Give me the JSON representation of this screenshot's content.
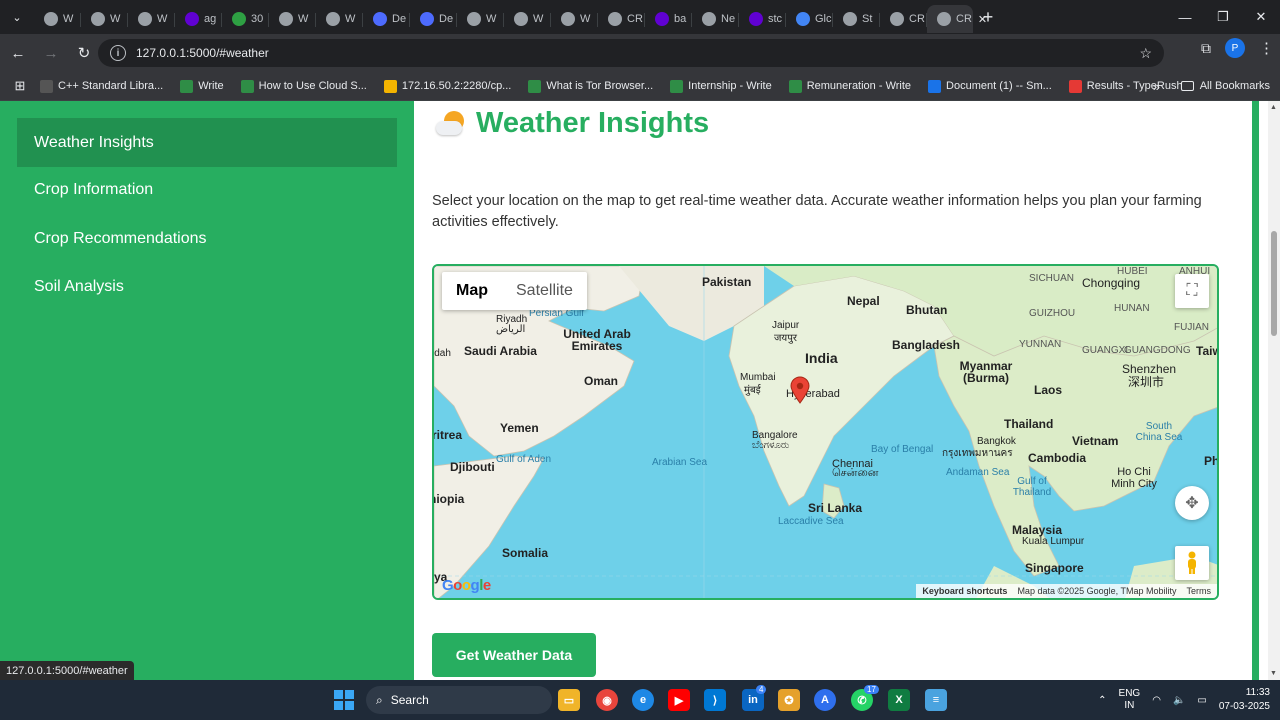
{
  "browser": {
    "tabs": [
      {
        "label": "W",
        "icon": "globe-icon",
        "color": "#9aa0a6"
      },
      {
        "label": "W",
        "icon": "globe-icon",
        "color": "#9aa0a6"
      },
      {
        "label": "W",
        "icon": "openai-icon",
        "color": "#9aa0a6"
      },
      {
        "label": "ag",
        "icon": "yahoo-icon",
        "color": "#6001d2"
      },
      {
        "label": "30",
        "icon": "px-icon",
        "color": "#2ea043"
      },
      {
        "label": "W",
        "icon": "globe-icon",
        "color": "#9aa0a6"
      },
      {
        "label": "W",
        "icon": "globe-icon",
        "color": "#9aa0a6"
      },
      {
        "label": "De",
        "icon": "deepseek-icon",
        "color": "#4d6bfe"
      },
      {
        "label": "De",
        "icon": "deepseek-icon",
        "color": "#4d6bfe"
      },
      {
        "label": "W",
        "icon": "globe-icon",
        "color": "#9aa0a6"
      },
      {
        "label": "W",
        "icon": "globe-icon",
        "color": "#9aa0a6"
      },
      {
        "label": "W",
        "icon": "globe-icon",
        "color": "#9aa0a6"
      },
      {
        "label": "CR",
        "icon": "globe-icon",
        "color": "#9aa0a6"
      },
      {
        "label": "ba",
        "icon": "yahoo-icon",
        "color": "#6001d2"
      },
      {
        "label": "Ne",
        "icon": "globe-icon",
        "color": "#9aa0a6"
      },
      {
        "label": "stc",
        "icon": "yahoo-icon",
        "color": "#6001d2"
      },
      {
        "label": "Glc",
        "icon": "spark-icon",
        "color": "#4285f4"
      },
      {
        "label": "St",
        "icon": "spark-icon",
        "color": "#9aa0a6"
      },
      {
        "label": "CR",
        "icon": "globe-icon",
        "color": "#9aa0a6"
      },
      {
        "label": "CR",
        "icon": "globe-icon",
        "color": "#9aa0a6"
      }
    ],
    "url": "127.0.0.1:5000/#weather",
    "profile_initial": "P",
    "bookmarks": [
      {
        "label": "C++ Standard Libra...",
        "icon": "cpp-icon",
        "color": "#555"
      },
      {
        "label": "Write",
        "icon": "gfg-icon",
        "color": "#2f8d46"
      },
      {
        "label": "How to Use Cloud S...",
        "icon": "gfg-icon",
        "color": "#2f8d46"
      },
      {
        "label": "172.16.50.2:2280/cp...",
        "icon": "gmail-icon",
        "color": "#f4b400"
      },
      {
        "label": "What is Tor Browser...",
        "icon": "gfg-icon",
        "color": "#2f8d46"
      },
      {
        "label": "Internship - Write",
        "icon": "gfg-icon",
        "color": "#2f8d46"
      },
      {
        "label": "Remuneration - Write",
        "icon": "gfg-icon",
        "color": "#2f8d46"
      },
      {
        "label": "Document (1) -- Sm...",
        "icon": "smallpdf-icon",
        "color": "#1a73e8"
      },
      {
        "label": "Results - TypeRush",
        "icon": "typerush-icon",
        "color": "#e53935"
      }
    ],
    "all_bookmarks": "All Bookmarks",
    "status_url": "127.0.0.1:5000/#weather"
  },
  "sidebar": {
    "items": [
      {
        "label": "Weather Insights",
        "active": true
      },
      {
        "label": "Crop Information",
        "active": false
      },
      {
        "label": "Crop Recommendations",
        "active": false
      },
      {
        "label": "Soil Analysis",
        "active": false
      }
    ]
  },
  "main": {
    "title": "Weather Insights",
    "intro": "Select your location on the map to get real-time weather data. Accurate weather information helps you plan your farming activities effectively.",
    "button": "Get Weather Data"
  },
  "map": {
    "type_buttons": [
      "Map",
      "Satellite"
    ],
    "selected_type": "Map",
    "labels": [
      {
        "text": "Pakistan",
        "kind": "big-lite"
      },
      {
        "text": "SICHUAN",
        "kind": "small"
      },
      {
        "text": "Chongqing",
        "kind": "label"
      },
      {
        "text": "HUBEI",
        "kind": "small"
      },
      {
        "text": "ANHUI",
        "kind": "small"
      },
      {
        "text": "Nepal",
        "kind": "label"
      },
      {
        "text": "Bhutan",
        "kind": "label"
      },
      {
        "text": "GUIZHOU",
        "kind": "small"
      },
      {
        "text": "HUNAN",
        "kind": "small"
      },
      {
        "text": "FUJIAN",
        "kind": "small"
      },
      {
        "text": "Persian Gulf",
        "kind": "sea"
      },
      {
        "text": "Riyadh",
        "kind": "label"
      },
      {
        "text": "الرياض",
        "kind": "label"
      },
      {
        "text": "United Arab Emirates",
        "kind": "label"
      },
      {
        "text": "Jaipur",
        "kind": "label"
      },
      {
        "text": "जयपुर",
        "kind": "label"
      },
      {
        "text": "Bangladesh",
        "kind": "label"
      },
      {
        "text": "YUNNAN",
        "kind": "small"
      },
      {
        "text": "GUANGXI",
        "kind": "small"
      },
      {
        "text": "GUANGDONG",
        "kind": "small"
      },
      {
        "text": "Taiw",
        "kind": "label"
      },
      {
        "text": "Saudi Arabia",
        "kind": "big-lite"
      },
      {
        "text": "India",
        "kind": "big"
      },
      {
        "text": "Myanmar (Burma)",
        "kind": "label"
      },
      {
        "text": "Shenzhen",
        "kind": "label"
      },
      {
        "text": "深圳市",
        "kind": "label"
      },
      {
        "text": "Oman",
        "kind": "label"
      },
      {
        "text": "Mumbai",
        "kind": "label"
      },
      {
        "text": "मुंबई",
        "kind": "label"
      },
      {
        "text": "Hyderabad",
        "kind": "label"
      },
      {
        "text": "Laos",
        "kind": "label"
      },
      {
        "text": "Yemen",
        "kind": "label"
      },
      {
        "text": "Thailand",
        "kind": "label"
      },
      {
        "text": "Vietnam",
        "kind": "label"
      },
      {
        "text": "South China Sea",
        "kind": "sea"
      },
      {
        "text": "Bangalore",
        "kind": "label"
      },
      {
        "text": "ಬೆಂಗಳೂರು",
        "kind": "label"
      },
      {
        "text": "Bay of Bengal",
        "kind": "sea"
      },
      {
        "text": "Bangkok",
        "kind": "label"
      },
      {
        "text": "กรุงเทพมหานคร",
        "kind": "label"
      },
      {
        "text": "Gulf of Aden",
        "kind": "sea"
      },
      {
        "text": "Arabian Sea",
        "kind": "sea"
      },
      {
        "text": "Chennai",
        "kind": "label"
      },
      {
        "text": "சென்னை",
        "kind": "label"
      },
      {
        "text": "Cambodia",
        "kind": "label"
      },
      {
        "text": "Djibouti",
        "kind": "label"
      },
      {
        "text": "Andaman Sea",
        "kind": "sea"
      },
      {
        "text": "Ho Chi Minh City",
        "kind": "label"
      },
      {
        "text": "Ph",
        "kind": "label"
      },
      {
        "text": "Gulf of Thailand",
        "kind": "sea"
      },
      {
        "text": "Sri Lanka",
        "kind": "label"
      },
      {
        "text": "Laccadive Sea",
        "kind": "sea"
      },
      {
        "text": "Malaysia",
        "kind": "label"
      },
      {
        "text": "Kuala Lumpur",
        "kind": "label"
      },
      {
        "text": "Somalia",
        "kind": "label"
      },
      {
        "text": "Singapore",
        "kind": "label"
      },
      {
        "text": "Ethiopia",
        "kind": "label"
      },
      {
        "text": "Eritrea",
        "kind": "label"
      },
      {
        "text": "Addah",
        "kind": "label"
      },
      {
        "text": "ya",
        "kind": "label"
      }
    ],
    "attribution": {
      "shortcuts": "Keyboard shortcuts",
      "data": "Map data ©2025 Google, TMap Mobility",
      "terms": "Terms"
    },
    "logo": "Google"
  },
  "taskbar": {
    "search": "Search",
    "lang_line1": "ENG",
    "lang_line2": "IN",
    "time": "11:33",
    "date": "07-03-2025",
    "badges": {
      "linkedin": "4",
      "whatsapp": "17"
    }
  }
}
